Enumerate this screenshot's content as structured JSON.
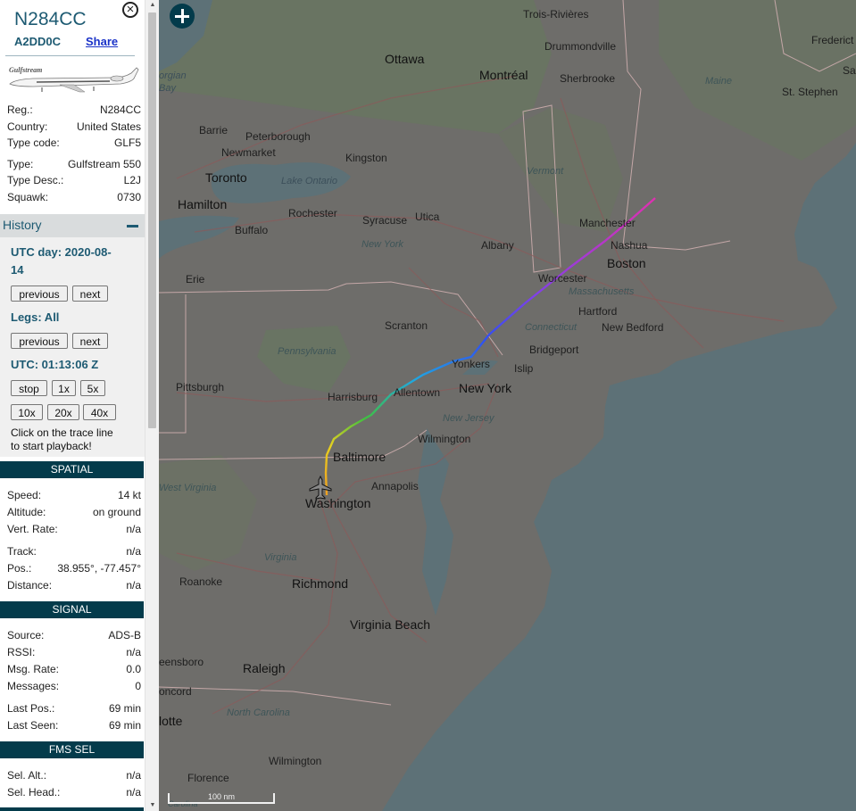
{
  "aircraft": {
    "callsign": "N284CC",
    "hex": "A2DD0C",
    "share_label": "Share",
    "photo_brand": "Gulfstream"
  },
  "details": [
    {
      "key": "Reg.:",
      "value": "N284CC"
    },
    {
      "key": "Country:",
      "value": "United States"
    },
    {
      "key": "Type code:",
      "value": "GLF5"
    },
    {
      "key": "Type:",
      "value": "Gulfstream 550"
    },
    {
      "key": "Type Desc.:",
      "value": "L2J"
    },
    {
      "key": "Squawk:",
      "value": "0730"
    }
  ],
  "history": {
    "title": "History",
    "utc_day_label": "UTC day: 2020-08-",
    "utc_day_cont": "14",
    "previous_label": "previous",
    "next_label": "next",
    "legs_label": "Legs: All",
    "utc_time_label": "UTC: 01:13:06 Z",
    "stop_label": "stop",
    "speeds": [
      "1x",
      "5x",
      "10x",
      "20x",
      "40x"
    ],
    "hint_line1": "Click on the trace line",
    "hint_line2": "to start playback!"
  },
  "spatial": {
    "title": "SPATIAL",
    "rows": [
      {
        "key": "Speed:",
        "value": "14 kt"
      },
      {
        "key": "Altitude:",
        "value": "on ground"
      },
      {
        "key": "Vert. Rate:",
        "value": "n/a"
      },
      {
        "key": "Track:",
        "value": "n/a"
      },
      {
        "key": "Pos.:",
        "value": "38.955°, -77.457°"
      },
      {
        "key": "Distance:",
        "value": "n/a"
      }
    ]
  },
  "signal": {
    "title": "SIGNAL",
    "rows": [
      {
        "key": "Source:",
        "value": "ADS-B"
      },
      {
        "key": "RSSI:",
        "value": "n/a"
      },
      {
        "key": "Msg. Rate:",
        "value": "0.0"
      },
      {
        "key": "Messages:",
        "value": "0"
      },
      {
        "key": "Last Pos.:",
        "value": "69 min"
      },
      {
        "key": "Last Seen:",
        "value": "69 min"
      }
    ]
  },
  "fms": {
    "title": "FMS SEL",
    "rows": [
      {
        "key": "Sel. Alt.:",
        "value": "n/a"
      },
      {
        "key": "Sel. Head.:",
        "value": "n/a"
      }
    ]
  },
  "map": {
    "scale_label": "100 nm",
    "labels": {
      "trois_rivieres": "Trois-Rivières",
      "drummondville": "Drummondville",
      "ottawa": "Ottawa",
      "montreal": "Montréal",
      "sherbrooke": "Sherbrooke",
      "maine": "Maine",
      "fredericton": "Frederict",
      "saint": "Sai",
      "st_stephen": "St. Stephen",
      "georgian": "orgian",
      "bay": "Bay",
      "barrie": "Barrie",
      "peterborough": "Peterborough",
      "newmarket": "Newmarket",
      "kingston": "Kingston",
      "toronto": "Toronto",
      "lake_ontario": "Lake Ontario",
      "vermont": "Vermont",
      "hamilton": "Hamilton",
      "rochester": "Rochester",
      "syracuse": "Syracuse",
      "utica": "Utica",
      "manchester": "Manchester",
      "buffalo": "Buffalo",
      "albany": "Albany",
      "nashua": "Nashua",
      "new_york_state": "New York",
      "boston": "Boston",
      "erie": "Erie",
      "worcester": "Worcester",
      "massachusetts": "Massachusetts",
      "hartford": "Hartford",
      "scranton": "Scranton",
      "connecticut": "Connecticut",
      "new_bedford": "New Bedford",
      "pennsylvania": "Pennsylvania",
      "bridgeport": "Bridgeport",
      "yonkers": "Yonkers",
      "islip": "Islip",
      "pittsburgh": "Pittsburgh",
      "harrisburg": "Harrisburg",
      "allentown": "Allentown",
      "new_york": "New York",
      "new_jersey": "New Jersey",
      "wilmington_de": "Wilmington",
      "baltimore": "Baltimore",
      "west_virginia": "West Virginia",
      "annapolis": "Annapolis",
      "washington": "Washington",
      "virginia": "Virginia",
      "roanoke": "Roanoke",
      "richmond": "Richmond",
      "virginia_beach": "Virginia Beach",
      "greensboro": "eensboro",
      "raleigh": "Raleigh",
      "concord": "oncord",
      "north_carolina": "North Carolina",
      "charlotte": "lotte",
      "florence": "Florence",
      "wilmington_nc": "Wilmington",
      "carolina": "Carolina"
    }
  },
  "colors": {
    "header_teal": "#033b4b",
    "title_blue": "#1d5a72",
    "map_water": "#5d7177",
    "map_land": "#6e6d6a",
    "trace_start": "#f0a020",
    "trace_end": "#e030b0"
  }
}
